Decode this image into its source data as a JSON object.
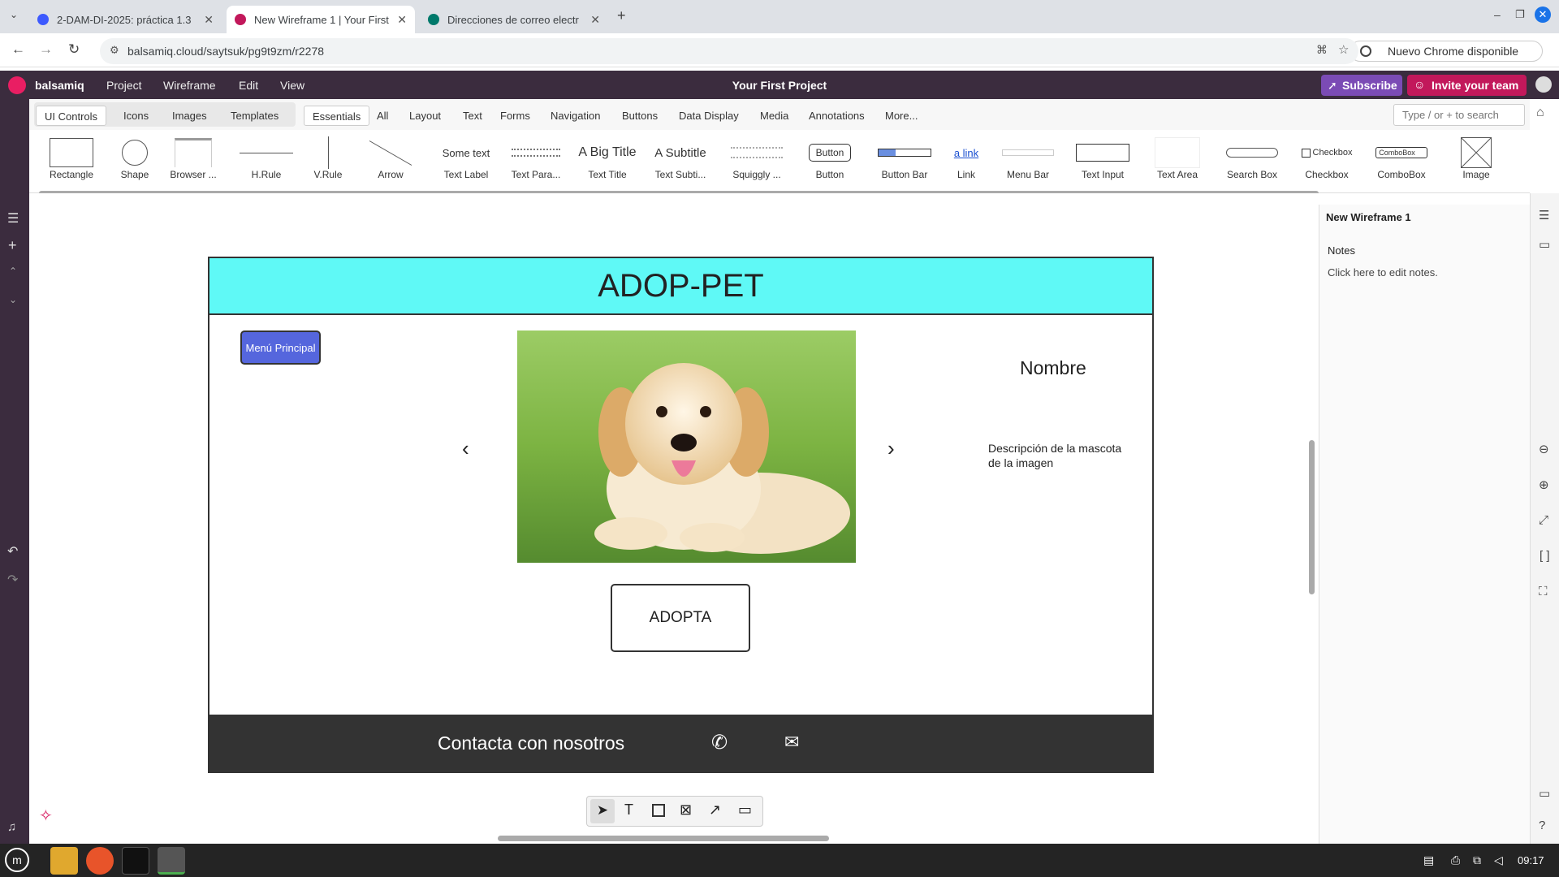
{
  "browser": {
    "tabs": [
      {
        "label": "2-DAM-DI-2025: práctica 1.3",
        "color": "#3d5afe"
      },
      {
        "label": "New Wireframe 1 | Your First",
        "color": "#c2185b"
      },
      {
        "label": "Direcciones de correo electr",
        "color": "#00796b"
      }
    ],
    "url": "balsamiq.cloud/saytsuk/pg9t9zm/r2278",
    "update_label": "Nuevo Chrome disponible"
  },
  "app": {
    "brand": "balsamiq",
    "menus": [
      "Project",
      "Wireframe",
      "Edit",
      "View"
    ],
    "project_title": "Your First Project",
    "subscribe_label": "Subscribe",
    "invite_label": "Invite your team"
  },
  "toolbar": {
    "left_tabs": [
      "UI Controls",
      "Icons",
      "Images",
      "Templates"
    ],
    "category_tabs": [
      "Essentials",
      "All",
      "Layout",
      "Text",
      "Forms",
      "Navigation",
      "Buttons",
      "Data Display",
      "Media",
      "Annotations",
      "More..."
    ],
    "search_placeholder": "Type / or + to search"
  },
  "library": [
    "Rectangle",
    "Shape",
    "Browser ...",
    "H.Rule",
    "V.Rule",
    "Arrow",
    "Text Label",
    "Text Para...",
    "Text Title",
    "Text Subti...",
    "Squiggly ...",
    "Button",
    "Button Bar",
    "Link",
    "Menu Bar",
    "Text Input",
    "Text Area",
    "Search Box",
    "Checkbox",
    "ComboBox",
    "Image"
  ],
  "library_previews": {
    "text_label": "Some text",
    "text_title": "A Big Title",
    "text_subtitle": "A Subtitle",
    "button": "Button",
    "link": "a link",
    "checkbox": "Checkbox",
    "combobox": "ComboBox"
  },
  "panel": {
    "title": "New Wireframe 1",
    "notes_label": "Notes",
    "notes_hint": "Click here to edit notes."
  },
  "wireframe": {
    "title": "ADOP-PET",
    "menu_button": "Menú Principal",
    "pet_name": "Nombre",
    "pet_description": "Descripción de la mascota de la imagen",
    "adopt_button": "ADOPTA",
    "footer_text": "Contacta con nosotros",
    "header_color": "#5ff9f6",
    "menu_color": "#5566dd"
  },
  "taskbar": {
    "time": "09:17"
  }
}
